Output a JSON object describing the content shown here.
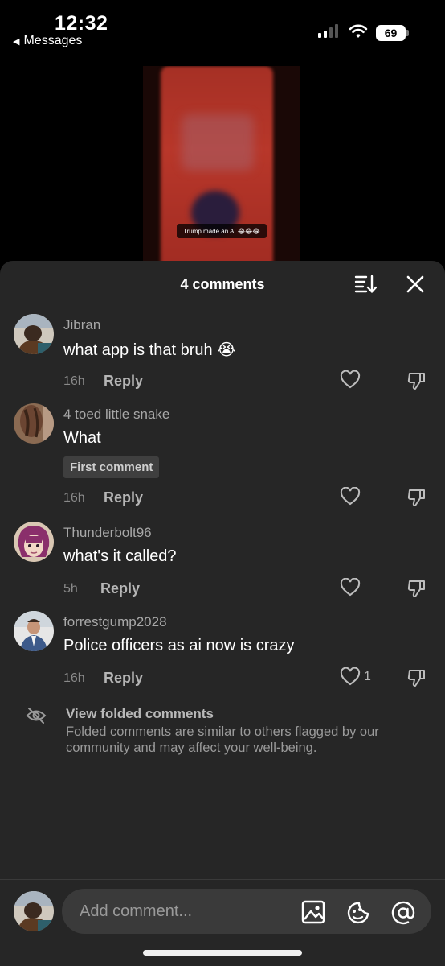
{
  "status_bar": {
    "time": "12:32",
    "back_label": "Messages",
    "battery": "69"
  },
  "video": {
    "caption": "Trump made an AI 😂😂😂"
  },
  "sheet": {
    "title": "4 comments"
  },
  "comments": [
    {
      "username": "Jibran",
      "text": "what app is that bruh 😭",
      "time": "16h",
      "reply_label": "Reply",
      "likes": "",
      "badge": ""
    },
    {
      "username": "4 toed little snake",
      "text": "What",
      "time": "16h",
      "reply_label": "Reply",
      "likes": "",
      "badge": "First comment"
    },
    {
      "username": "Thunderbolt96",
      "text": "what's it called?",
      "time": "5h",
      "reply_label": "Reply",
      "likes": "",
      "badge": ""
    },
    {
      "username": "forrestgump2028",
      "text": "Police officers as ai now is crazy",
      "time": "16h",
      "reply_label": "Reply",
      "likes": "1",
      "badge": ""
    }
  ],
  "folded": {
    "title": "View folded comments",
    "description": "Folded comments are similar to others flagged by our community and may affect your well-being."
  },
  "composer": {
    "placeholder": "Add comment..."
  }
}
